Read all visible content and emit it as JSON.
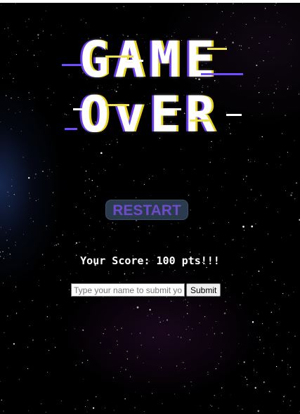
{
  "game_over": {
    "title_line_1": "GAME",
    "title_line_2": "OvER"
  },
  "restart_label": "RESTART",
  "score_text": "Your Score: 100 pts!!!",
  "name_form": {
    "input_value": "",
    "input_placeholder": "Type your name to submit your score",
    "submit_label": "Submit"
  },
  "colors": {
    "background": "#000000",
    "title": "#ffffff",
    "glitch_purple": "#6a3df0",
    "glitch_yellow": "#e9d21a",
    "restart_bg": "#2b3b4e",
    "restart_text": "#6e4bc7"
  }
}
